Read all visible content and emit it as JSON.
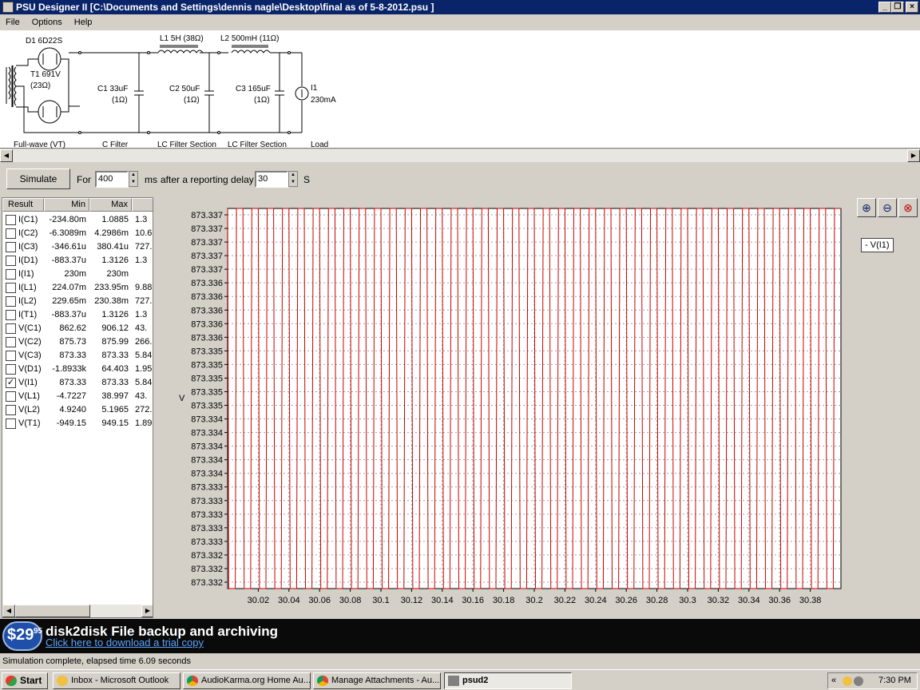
{
  "window": {
    "title": "PSU Designer II  [C:\\Documents and Settings\\dennis nagle\\Desktop\\final as of 5-8-2012.psu ]"
  },
  "menu": [
    "File",
    "Options",
    "Help"
  ],
  "schematic": {
    "d1": "D1 6D22S",
    "t1": "T1 691V",
    "t1r": "(23Ω)",
    "l1": "L1 5H (38Ω)",
    "l2": "L2 500mH (11Ω)",
    "c1": "C1 33uF",
    "c1r": "(1Ω)",
    "c2": "C2 50uF",
    "c2r": "(1Ω)",
    "c3": "C3 165uF",
    "c3r": "(1Ω)",
    "i1": "I1",
    "i1v": "230mA",
    "sections": [
      "Full-wave (VT)",
      "C Filter",
      "LC Filter Section",
      "LC Filter Section",
      "Load"
    ]
  },
  "controls": {
    "simulate": "Simulate",
    "for_label": "For",
    "for_value": "400",
    "ms": "ms",
    "delay_label": "after a reporting delay of",
    "delay_value": "30",
    "s": "S"
  },
  "results": {
    "headers": [
      "Result",
      "Min",
      "Max"
    ],
    "rows": [
      {
        "name": "I(C1)",
        "min": "-234.80m",
        "max": "1.0885",
        "extra": "1.3",
        "checked": false
      },
      {
        "name": "I(C2)",
        "min": "-6.3089m",
        "max": "4.2986m",
        "extra": "10.6",
        "checked": false
      },
      {
        "name": "I(C3)",
        "min": "-346.61u",
        "max": "380.41u",
        "extra": "727.",
        "checked": false
      },
      {
        "name": "I(D1)",
        "min": "-883.37u",
        "max": "1.3126",
        "extra": "1.3",
        "checked": false
      },
      {
        "name": "I(I1)",
        "min": "230m",
        "max": "230m",
        "extra": "",
        "checked": false
      },
      {
        "name": "I(L1)",
        "min": "224.07m",
        "max": "233.95m",
        "extra": "9.88",
        "checked": false
      },
      {
        "name": "I(L2)",
        "min": "229.65m",
        "max": "230.38m",
        "extra": "727.",
        "checked": false
      },
      {
        "name": "I(T1)",
        "min": "-883.37u",
        "max": "1.3126",
        "extra": "1.3",
        "checked": false
      },
      {
        "name": "V(C1)",
        "min": "862.62",
        "max": "906.12",
        "extra": "43.",
        "checked": false
      },
      {
        "name": "V(C2)",
        "min": "875.73",
        "max": "875.99",
        "extra": "266.",
        "checked": false
      },
      {
        "name": "V(C3)",
        "min": "873.33",
        "max": "873.33",
        "extra": "5.84",
        "checked": false
      },
      {
        "name": "V(D1)",
        "min": "-1.8933k",
        "max": "64.403",
        "extra": "1.95",
        "checked": false
      },
      {
        "name": "V(I1)",
        "min": "873.33",
        "max": "873.33",
        "extra": "5.84",
        "checked": true
      },
      {
        "name": "V(L1)",
        "min": "-4.7227",
        "max": "38.997",
        "extra": "43.",
        "checked": false
      },
      {
        "name": "V(L2)",
        "min": "4.9240",
        "max": "5.1965",
        "extra": "272.",
        "checked": false
      },
      {
        "name": "V(T1)",
        "min": "-949.15",
        "max": "949.15",
        "extra": "1.89",
        "checked": false
      }
    ]
  },
  "chart_data": {
    "type": "line",
    "ylabel": "V",
    "xlabel": "",
    "ylim": [
      873.332,
      873.337
    ],
    "y_ticks": [
      "873.337",
      "873.337",
      "873.337",
      "873.337",
      "873.337",
      "873.336",
      "873.336",
      "873.336",
      "873.336",
      "873.336",
      "873.335",
      "873.335",
      "873.335",
      "873.335",
      "873.335",
      "873.334",
      "873.334",
      "873.334",
      "873.334",
      "873.334",
      "873.333",
      "873.333",
      "873.333",
      "873.333",
      "873.333",
      "873.332",
      "873.332",
      "873.332"
    ],
    "x_ticks": [
      "30.02",
      "30.04",
      "30.06",
      "30.08",
      "30.1",
      "30.12",
      "30.14",
      "30.16",
      "30.18",
      "30.2",
      "30.22",
      "30.24",
      "30.26",
      "30.28",
      "30.3",
      "30.32",
      "30.34",
      "30.36",
      "30.38"
    ],
    "xlim": [
      30.0,
      30.4
    ],
    "series": [
      {
        "name": "V(I1)",
        "color": "#cc0000",
        "period": 0.01,
        "min": 873.332,
        "max": 873.337
      }
    ],
    "grid": true,
    "legend": "top-right"
  },
  "banner": {
    "price": "$29",
    "cents": "95",
    "title": "disk2disk File backup and archiving",
    "subtitle": "Click here to download a trial copy"
  },
  "status": "Simulation complete, elapsed time 6.09 seconds",
  "taskbar": {
    "start": "Start",
    "items": [
      "Inbox - Microsoft Outlook",
      "AudioKarma.org Home Au...",
      "Manage Attachments - Au...",
      "psud2"
    ],
    "clock": "7:30 PM"
  }
}
